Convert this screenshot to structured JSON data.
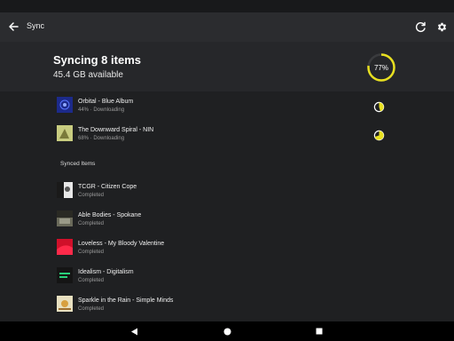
{
  "appbar": {
    "title": "Sync"
  },
  "summary": {
    "heading": "Syncing 8 items",
    "available": "45.4 GB available",
    "progress_label": "77%",
    "progress_fraction": 0.77,
    "accent": "#e8e020"
  },
  "downloading": [
    {
      "name": "Orbital - Blue Album",
      "status": "44% · Downloading",
      "progress": 0.44,
      "art_color": "#1c2a8a"
    },
    {
      "name": "The Downward Spiral - NIN",
      "status": "68% · Downloading",
      "progress": 0.68,
      "art_color": "#b8c070"
    }
  ],
  "synced_label": "Synced Items",
  "synced": [
    {
      "name": "TCGR - Citizen Cope",
      "status": "Completed",
      "art_color": "#e8e8e8"
    },
    {
      "name": "Able Bodies - Spokane",
      "status": "Completed",
      "art_color": "#6a6a5a"
    },
    {
      "name": "Loveless - My Bloody Valentine",
      "status": "Completed",
      "art_color": "#d0102a"
    },
    {
      "name": "Idealism - Digitalism",
      "status": "Completed",
      "art_color": "#1a1a1a"
    },
    {
      "name": "Sparkle in the Rain - Simple Minds",
      "status": "Completed",
      "art_color": "#e0d8b8"
    }
  ],
  "icons": {
    "back": "arrow-left-icon",
    "refresh": "refresh-icon",
    "settings": "gear-icon",
    "nav_back": "triangle-back-icon",
    "nav_home": "circle-home-icon",
    "nav_recents": "square-recents-icon"
  }
}
